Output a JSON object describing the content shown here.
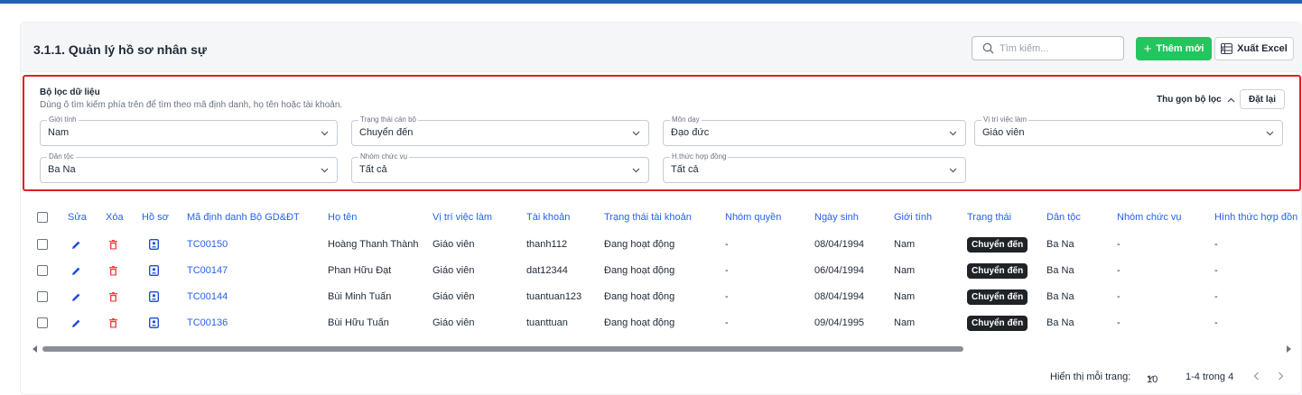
{
  "header": {
    "title": "3.1.1. Quản lý hồ sơ nhân sự",
    "search_placeholder": "Tìm kiếm...",
    "add_label": "Thêm mới",
    "excel_label": "Xuất Excel"
  },
  "filter": {
    "title": "Bộ lọc dữ liệu",
    "hint": "Dùng ô tìm kiếm phía trên để tìm theo mã định danh, họ tên hoặc tài khoản.",
    "collapse_label": "Thu gọn bộ lọc",
    "reset_label": "Đặt lại",
    "fields": [
      {
        "label": "Giới tính",
        "value": "Nam"
      },
      {
        "label": "Trạng thái cán bộ",
        "value": "Chuyển đến"
      },
      {
        "label": "Môn dạy",
        "value": "Đạo đức"
      },
      {
        "label": "Vị trí việc làm",
        "value": "Giáo viên"
      },
      {
        "label": "Dân tộc",
        "value": "Ba Na"
      },
      {
        "label": "Nhóm chức vụ",
        "value": "Tất cả"
      },
      {
        "label": "H.thức hợp đồng",
        "value": "Tất cả"
      }
    ]
  },
  "table": {
    "columns": [
      "Sửa",
      "Xóa",
      "Hồ sơ",
      "Mã định danh Bộ GD&ĐT",
      "Họ tên",
      "Vị trí việc làm",
      "Tài khoản",
      "Trạng thái tài khoản",
      "Nhóm quyền",
      "Ngày sinh",
      "Giới tính",
      "Trạng thái",
      "Dân tộc",
      "Nhóm chức vụ",
      "Hình thức hợp đồn"
    ],
    "rows": [
      {
        "id": "TC00150",
        "name": "Hoàng Thanh Thành",
        "position": "Giáo viên",
        "account": "thanh112",
        "account_status": "Đang hoạt động",
        "role": "-",
        "dob": "08/04/1994",
        "gender": "Nam",
        "status": "Chuyển đến",
        "ethnic": "Ba Na",
        "group": "-",
        "contract": "-"
      },
      {
        "id": "TC00147",
        "name": "Phan Hữu Đạt",
        "position": "Giáo viên",
        "account": "dat12344",
        "account_status": "Đang hoạt động",
        "role": "-",
        "dob": "06/04/1994",
        "gender": "Nam",
        "status": "Chuyển đến",
        "ethnic": "Ba Na",
        "group": "-",
        "contract": "-"
      },
      {
        "id": "TC00144",
        "name": "Bùi Minh Tuấn",
        "position": "Giáo viên",
        "account": "tuantuan123",
        "account_status": "Đang hoạt động",
        "role": "-",
        "dob": "08/04/1994",
        "gender": "Nam",
        "status": "Chuyển đến",
        "ethnic": "Ba Na",
        "group": "-",
        "contract": "-"
      },
      {
        "id": "TC00136",
        "name": "Bùi Hữu Tuấn",
        "position": "Giáo viên",
        "account": "tuanttuan",
        "account_status": "Đang hoạt động",
        "role": "-",
        "dob": "09/04/1995",
        "gender": "Nam",
        "status": "Chuyển đến",
        "ethnic": "Ba Na",
        "group": "-",
        "contract": "-"
      }
    ]
  },
  "pagination": {
    "per_page_label": "Hiển thị mỗi trang:",
    "per_page": "10",
    "range": "1-4 trong 4"
  },
  "colors": {
    "primary": "#2563eb",
    "add_button": "#22c55e",
    "delete_icon": "#ef4444",
    "highlight_border": "#e11d24",
    "badge": "#1f2328"
  }
}
